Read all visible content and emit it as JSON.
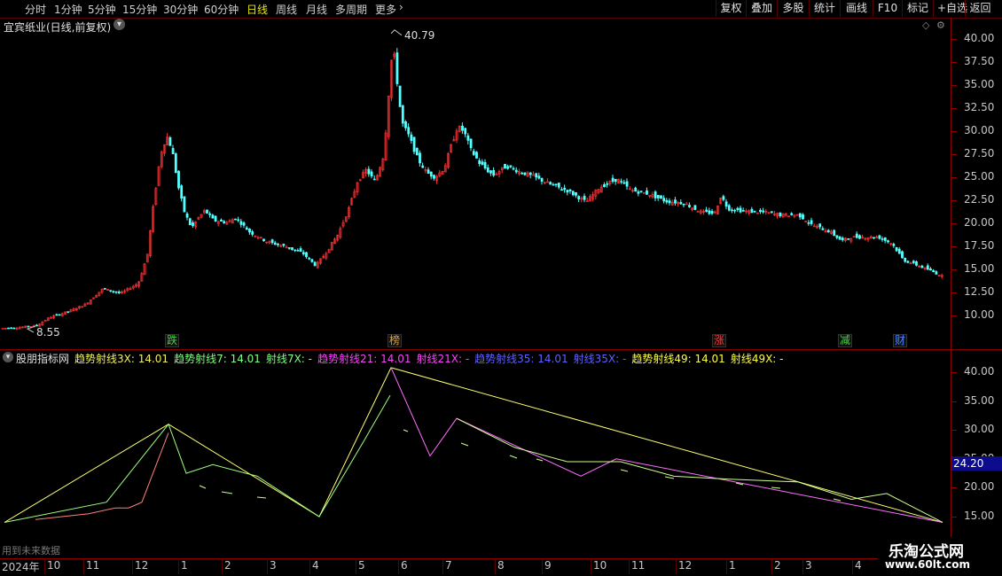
{
  "toolbar": {
    "periods": [
      "分时",
      "1分钟",
      "5分钟",
      "15分钟",
      "30分钟",
      "60分钟",
      "日线",
      "周线",
      "月线",
      "多周期",
      "更多"
    ],
    "active_period": "日线",
    "buttons": [
      "复权",
      "叠加",
      "多股",
      "统计",
      "画线",
      "F10",
      "标记",
      "+自选",
      "返回"
    ]
  },
  "main": {
    "title": "宜宾纸业(日线,前复权)",
    "high_label": "40.79",
    "low_label": "8.55",
    "y_ticks": [
      "40.00",
      "37.50",
      "35.00",
      "32.50",
      "30.00",
      "27.50",
      "25.00",
      "22.50",
      "20.00",
      "17.50",
      "15.00",
      "12.50",
      "10.00"
    ],
    "signals": [
      {
        "text": "跌",
        "color": "#4ad04a"
      },
      {
        "text": "榜",
        "color": "#e0a040"
      },
      {
        "text": "涨",
        "color": "#e04040"
      },
      {
        "text": "减",
        "color": "#4ad04a"
      },
      {
        "text": "财",
        "color": "#4a80ff"
      }
    ]
  },
  "indicator": {
    "name": "股朋指标网",
    "legend": [
      {
        "text": "趋势射线3X: 14.01",
        "color": "#f0f060"
      },
      {
        "text": "趋势射线7: 14.01",
        "color": "#80ff80"
      },
      {
        "text": "射线7X: -",
        "color": "#80ff80"
      },
      {
        "text": "趋势射线21: 14.01",
        "color": "#ff40ff"
      },
      {
        "text": "射线21X: -",
        "color": "#ff40ff"
      },
      {
        "text": "趋势射线35: 14.01",
        "color": "#6060ff"
      },
      {
        "text": "射线35X: -",
        "color": "#6060ff"
      },
      {
        "text": "趋势射线49: 14.01",
        "color": "#ffff40"
      },
      {
        "text": "射线49X: -",
        "color": "#ffff40"
      }
    ],
    "y_ticks": [
      "40.00",
      "35.00",
      "30.00",
      "25.00",
      "20.00",
      "15.00"
    ],
    "cursor_value": "24.20",
    "bottom_text": "用到未来数据"
  },
  "x_axis": {
    "labels": [
      "2024年",
      "10",
      "11",
      "12",
      "1",
      "2",
      "3",
      "4",
      "5",
      "6",
      "7",
      "8",
      "9",
      "10",
      "11",
      "12",
      "1",
      "2",
      "3",
      "4"
    ]
  },
  "watermark": {
    "title": "乐淘公式网",
    "url": "www.60lt.com"
  },
  "colors": {
    "up": "#ff3232",
    "down": "#54ffff",
    "border": "#8a0000",
    "active": "#e8e800"
  },
  "chart_data": {
    "type": "candlestick",
    "ylim": [
      8,
      42
    ],
    "close_path": [
      [
        0,
        8.6
      ],
      [
        20,
        8.7
      ],
      [
        40,
        8.9
      ],
      [
        55,
        9.8
      ],
      [
        75,
        10.4
      ],
      [
        95,
        11.2
      ],
      [
        115,
        12.9
      ],
      [
        135,
        12.4
      ],
      [
        155,
        13.5
      ],
      [
        165,
        16.5
      ],
      [
        172,
        22
      ],
      [
        180,
        27.5
      ],
      [
        187,
        29.5
      ],
      [
        193,
        28
      ],
      [
        200,
        24
      ],
      [
        207,
        21.2
      ],
      [
        215,
        19.5
      ],
      [
        222,
        20.5
      ],
      [
        230,
        21.4
      ],
      [
        240,
        20.3
      ],
      [
        255,
        20.1
      ],
      [
        265,
        20.6
      ],
      [
        280,
        19.1
      ],
      [
        300,
        18
      ],
      [
        320,
        17.5
      ],
      [
        340,
        16.8
      ],
      [
        355,
        15.4
      ],
      [
        365,
        16.6
      ],
      [
        380,
        18.8
      ],
      [
        392,
        21.5
      ],
      [
        402,
        24.5
      ],
      [
        412,
        25.8
      ],
      [
        422,
        24.5
      ],
      [
        432,
        27.5
      ],
      [
        438,
        35
      ],
      [
        442,
        39.5
      ],
      [
        446,
        36
      ],
      [
        452,
        31
      ],
      [
        460,
        29.5
      ],
      [
        470,
        27
      ],
      [
        480,
        25.5
      ],
      [
        490,
        25
      ],
      [
        500,
        26
      ],
      [
        508,
        28.5
      ],
      [
        515,
        30.5
      ],
      [
        522,
        30
      ],
      [
        530,
        28
      ],
      [
        540,
        26.5
      ],
      [
        555,
        25.2
      ],
      [
        570,
        26.2
      ],
      [
        585,
        25.6
      ],
      [
        600,
        25.1
      ],
      [
        620,
        24.2
      ],
      [
        640,
        23.5
      ],
      [
        660,
        22.3
      ],
      [
        675,
        23.9
      ],
      [
        695,
        24.8
      ],
      [
        710,
        23.6
      ],
      [
        730,
        23.2
      ],
      [
        750,
        22.4
      ],
      [
        770,
        22.2
      ],
      [
        790,
        21.2
      ],
      [
        805,
        21.1
      ],
      [
        812,
        23
      ],
      [
        820,
        21.6
      ],
      [
        840,
        21.3
      ],
      [
        860,
        21.2
      ],
      [
        880,
        20.9
      ],
      [
        900,
        20.9
      ],
      [
        915,
        19.8
      ],
      [
        935,
        19.1
      ],
      [
        948,
        18.1
      ],
      [
        960,
        18.5
      ],
      [
        975,
        18.5
      ],
      [
        990,
        18.5
      ],
      [
        1005,
        17.8
      ],
      [
        1018,
        16
      ],
      [
        1035,
        15.4
      ],
      [
        1050,
        14.8
      ],
      [
        1063,
        14.2
      ]
    ],
    "highlights": [
      {
        "label": "40.79",
        "value": 40.79
      },
      {
        "label": "8.55",
        "value": 8.55
      }
    ],
    "rays": [
      {
        "color": "#ffff70",
        "points": [
          [
            5,
            14.0
          ],
          [
            190,
            31.0
          ],
          [
            360,
            15.0
          ],
          [
            441,
            40.79
          ],
          [
            1063,
            14.01
          ]
        ]
      },
      {
        "color": "#a0ff80",
        "points": [
          [
            5,
            14.0
          ],
          [
            120,
            17.5
          ],
          [
            190,
            31.0
          ],
          [
            210,
            22.5
          ],
          [
            240,
            24.0
          ],
          [
            290,
            22.0
          ],
          [
            360,
            15.0
          ],
          [
            410,
            28.0
          ],
          [
            440,
            36.0
          ]
        ]
      },
      {
        "color": "#ff70ff",
        "points": [
          [
            441,
            40.79
          ],
          [
            485,
            25.5
          ],
          [
            515,
            32.0
          ],
          [
            655,
            22.0
          ],
          [
            695,
            25.0
          ],
          [
            1063,
            14.01
          ]
        ]
      },
      {
        "color": "#d0ff90",
        "points": [
          [
            515,
            32.0
          ],
          [
            580,
            27.0
          ],
          [
            640,
            24.5
          ],
          [
            700,
            24.5
          ],
          [
            760,
            22.0
          ],
          [
            820,
            21.5
          ],
          [
            900,
            21.0
          ],
          [
            960,
            18.0
          ],
          [
            1000,
            19.0
          ],
          [
            1063,
            14.01
          ]
        ]
      },
      {
        "color": "#ff8080",
        "points": [
          [
            40,
            14.5
          ],
          [
            100,
            15.5
          ],
          [
            130,
            16.5
          ],
          [
            145,
            16.5
          ],
          [
            160,
            17.5
          ],
          [
            175,
            23.5
          ],
          [
            190,
            29.5
          ]
        ]
      }
    ]
  }
}
